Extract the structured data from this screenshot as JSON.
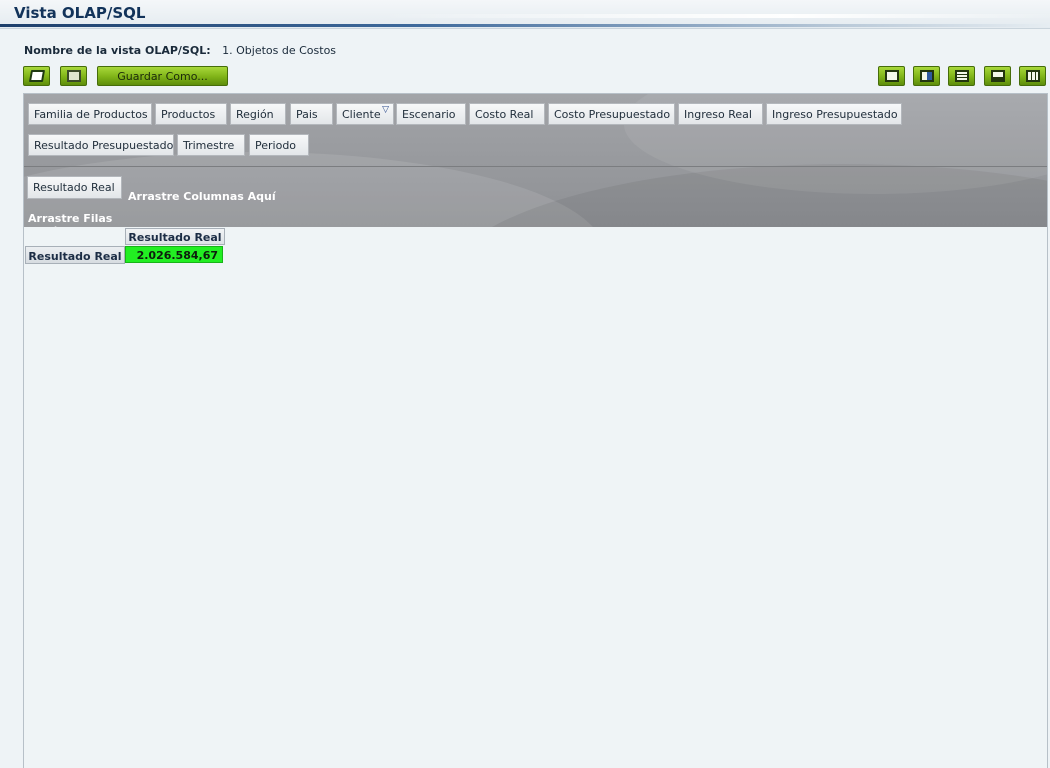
{
  "title": "Vista OLAP/SQL",
  "view_name": {
    "label": "Nombre de la vista OLAP/SQL:",
    "value": "1. Objetos de Costos"
  },
  "toolbar": {
    "left": [
      {
        "name": "edit-icon"
      },
      {
        "name": "save-icon"
      }
    ],
    "save_as_label": "Guardar Como...",
    "right": [
      {
        "name": "new-document-icon"
      },
      {
        "name": "export-icon"
      },
      {
        "name": "table-icon"
      },
      {
        "name": "chart-icon"
      },
      {
        "name": "excel-icon"
      }
    ],
    "accent_color": "#7fb317"
  },
  "available_fields": {
    "row1": [
      "Familia de Productos",
      "Productos",
      "Región",
      "Pais",
      "Cliente",
      "Escenario",
      "Costo Real",
      "Costo Presupuestado",
      "Ingreso Real",
      "Ingreso Presupuestado"
    ],
    "row2": [
      "Resultado Presupuestado",
      "Trimestre",
      "Periodo"
    ],
    "filtered_field": "Cliente"
  },
  "column_area": {
    "placed_field": "Resultado Real",
    "drop_hint": "Arrastre Columnas Aquí"
  },
  "row_area": {
    "drop_hint": "Arrastre Filas Aquí"
  },
  "pivot": {
    "column_header": "Resultado Real",
    "row_header": "Resultado Real",
    "value": "2.026.584,67",
    "value_color": "#22ee22"
  }
}
